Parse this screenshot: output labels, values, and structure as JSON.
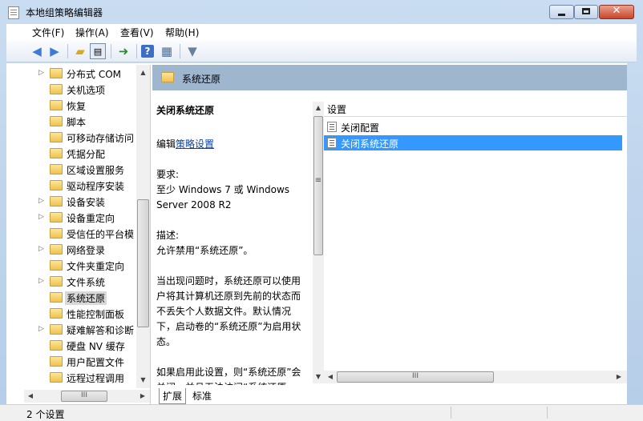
{
  "window": {
    "title": "本地组策略编辑器",
    "close_glyph": "✕"
  },
  "menu": [
    {
      "label": "文件(F)"
    },
    {
      "label": "操作(A)"
    },
    {
      "label": "查看(V)"
    },
    {
      "label": "帮助(H)"
    }
  ],
  "toolbar": {
    "icons": [
      "back-arrow-icon",
      "forward-arrow-icon",
      "up-folder-icon",
      "show-hide-console-tree-icon",
      "export-list-icon",
      "help-icon",
      "properties-icon",
      "filter-icon"
    ]
  },
  "tree": {
    "items": [
      {
        "label": "分布式 COM",
        "expandable": true
      },
      {
        "label": "关机选项",
        "expandable": false
      },
      {
        "label": "恢复",
        "expandable": false
      },
      {
        "label": "脚本",
        "expandable": false
      },
      {
        "label": "可移动存储访问",
        "expandable": false
      },
      {
        "label": "凭据分配",
        "expandable": false
      },
      {
        "label": "区域设置服务",
        "expandable": false
      },
      {
        "label": "驱动程序安装",
        "expandable": false
      },
      {
        "label": "设备安装",
        "expandable": true
      },
      {
        "label": "设备重定向",
        "expandable": true
      },
      {
        "label": "受信任的平台模",
        "expandable": false
      },
      {
        "label": "网络登录",
        "expandable": true
      },
      {
        "label": "文件夹重定向",
        "expandable": false
      },
      {
        "label": "文件系统",
        "expandable": true
      },
      {
        "label": "系统还原",
        "expandable": false,
        "selected": true
      },
      {
        "label": "性能控制面板",
        "expandable": false
      },
      {
        "label": "疑难解答和诊断",
        "expandable": true
      },
      {
        "label": "硬盘 NV 缓存",
        "expandable": false
      },
      {
        "label": "用户配置文件",
        "expandable": false
      },
      {
        "label": "远程过程调用",
        "expandable": false
      }
    ],
    "expand_glyph": "▷",
    "scroll_glyphs": {
      "up": "▲",
      "down": "▼",
      "left": "◀",
      "right": "▶",
      "grip": "III"
    }
  },
  "banner": {
    "title": "系统还原"
  },
  "description": {
    "title": "关闭系统还原",
    "edit_prefix": "编辑",
    "edit_link": "策略设置",
    "paragraphs": [
      "要求:",
      "至少 Windows 7 或 Windows Server 2008 R2",
      "描述:",
      "允许禁用“系统还原”。",
      "当出现问题时，系统还原可以使用户将其计算机还原到先前的状态而不丢失个人数据文件。默认情况下，启动卷的“系统还原”为启用状态。",
      "如果启用此设置，则“系统还原”会关闭，并且无法访问“系统还原"
    ],
    "scrollbar_grip": "≡"
  },
  "list": {
    "header": "设置",
    "rows": [
      {
        "label": "关闭配置",
        "selected": false
      },
      {
        "label": "关闭系统还原",
        "selected": true
      }
    ]
  },
  "tabs": [
    {
      "label": "扩展"
    },
    {
      "label": "标准"
    }
  ],
  "status": {
    "text": "2 个设置"
  }
}
